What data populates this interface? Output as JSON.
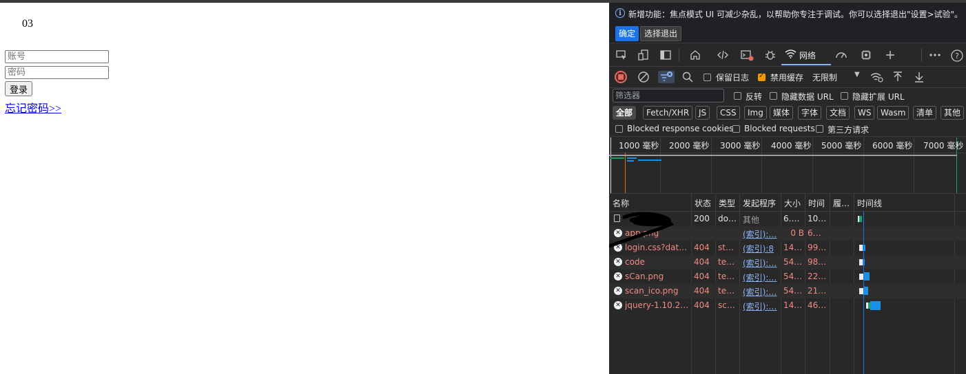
{
  "page": {
    "number": "03",
    "username_placeholder": "账号",
    "password_placeholder": "密码",
    "login_label": "登录",
    "forgot_label": "忘记密码>>"
  },
  "devtools": {
    "notice": {
      "text": "新增功能：焦点模式 UI 可减少杂乱，以帮助你专注于调试。你可以选择退出\"设置>试验\"。",
      "confirm": "确定",
      "exit": "选择退出"
    },
    "tabs": {
      "network": "网络"
    },
    "net_toolbar": {
      "preserve_log": "保留日志",
      "disable_cache": "禁用缓存",
      "throttle": "无限制",
      "disable_cache_checked": true
    },
    "filter": {
      "placeholder": "筛选器",
      "invert": "反转",
      "hide_data_url": "隐藏数据 URL",
      "hide_ext_url": "隐藏扩展 URL"
    },
    "types": [
      "全部",
      "Fetch/XHR",
      "JS",
      "CSS",
      "Img",
      "媒体",
      "字体",
      "文档",
      "WS",
      "Wasm",
      "清单",
      "其他"
    ],
    "block": {
      "blocked_cookies": "Blocked response cookies",
      "blocked_requests": "Blocked requests",
      "third_party": "第三方请求"
    },
    "overview_ticks": [
      "1000 毫秒",
      "2000 毫秒",
      "3000 毫秒",
      "4000 毫秒",
      "5000 毫秒",
      "6000 毫秒",
      "7000 毫秒"
    ],
    "columns": {
      "name": "名称",
      "status": "状态",
      "type": "类型",
      "initiator": "发起程序",
      "size": "大小",
      "time": "时间",
      "fulfilled": "履…",
      "waterfall": "时间线"
    },
    "rows": [
      {
        "name": "",
        "status": "200",
        "type": "do…",
        "initiator": "其他",
        "size": "6.…",
        "time": "10…",
        "error": false,
        "initiator_link": false
      },
      {
        "name": "app.png",
        "status": "",
        "type": "",
        "initiator": "(索引):…",
        "size": "0 B",
        "time": "6…",
        "error": true,
        "initiator_link": true
      },
      {
        "name": "login.css?date…",
        "status": "404",
        "type": "st…",
        "initiator": "(索引):8",
        "size": "14…",
        "time": "99…",
        "error": true,
        "initiator_link": true
      },
      {
        "name": "code",
        "status": "404",
        "type": "te…",
        "initiator": "(索引):…",
        "size": "54…",
        "time": "98…",
        "error": true,
        "initiator_link": true
      },
      {
        "name": "sCan.png",
        "status": "404",
        "type": "te…",
        "initiator": "(索引):…",
        "size": "54…",
        "time": "22…",
        "error": true,
        "initiator_link": true
      },
      {
        "name": "scan_ico.png",
        "status": "404",
        "type": "te…",
        "initiator": "(索引):…",
        "size": "54…",
        "time": "21…",
        "error": true,
        "initiator_link": true
      },
      {
        "name": "jquery-1.10.2.…",
        "status": "404",
        "type": "sc…",
        "initiator": "(索引):…",
        "size": "14…",
        "time": "46…",
        "error": true,
        "initiator_link": true
      }
    ],
    "colors": {
      "accent": "#8ab4f8",
      "error": "#f28b82",
      "checkbox": "#f29900",
      "waterfall": "#1a8fe3"
    }
  }
}
